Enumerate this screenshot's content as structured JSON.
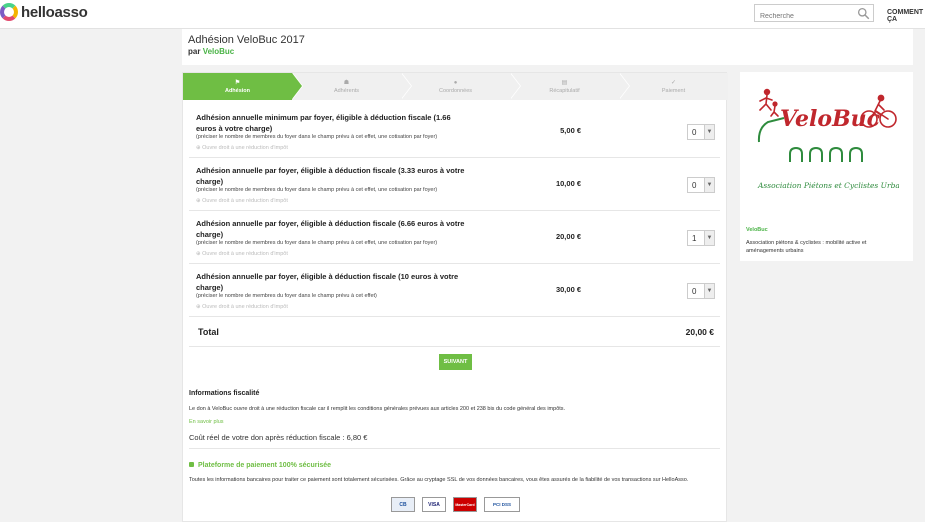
{
  "topbar": {
    "logo_text": "helloasso",
    "search_placeholder": "Recherche",
    "connect_label": "COMMENT ÇA"
  },
  "header": {
    "title": "Adhésion VeloBuc 2017",
    "by_prefix": "par",
    "organization": "VeloBuc"
  },
  "steps": [
    {
      "label": "Adhésion",
      "icon": "flag-icon",
      "glyph": "⚑",
      "active": true
    },
    {
      "label": "Adhérents",
      "icon": "users-icon",
      "glyph": "☗",
      "active": false
    },
    {
      "label": "Coordonnées",
      "icon": "user-icon",
      "glyph": "●",
      "active": false
    },
    {
      "label": "Récapitulatif",
      "icon": "list-icon",
      "glyph": "▤",
      "active": false
    },
    {
      "label": "Paiement",
      "icon": "check-icon",
      "glyph": "✓",
      "active": false
    }
  ],
  "rows": [
    {
      "title": "Adhésion annuelle minimum par foyer, éligible à déduction fiscale (1.66 euros à votre charge)",
      "note": "(préciser le nombre de membres du foyer dans le champ prévu à cet effet, une cotisation par foyer)",
      "tax": "⊕ Ouvre droit à une réduction d'impôt",
      "price": "5,00 €",
      "qty": "0"
    },
    {
      "title": "Adhésion annuelle par foyer, éligible à déduction fiscale (3.33 euros à votre charge)",
      "note": "(préciser le nombre de membres du foyer dans le champ prévu à cet effet, une cotisation par foyer)",
      "tax": "⊕ Ouvre droit à une réduction d'impôt",
      "price": "10,00 €",
      "qty": "0"
    },
    {
      "title": "Adhésion annuelle par foyer, éligible à déduction fiscale (6.66 euros à votre charge)",
      "note": "(préciser le nombre de membres du foyer dans le champ prévu à cet effet, une cotisation par foyer)",
      "tax": "⊕ Ouvre droit à une réduction d'impôt",
      "price": "20,00 €",
      "qty": "1"
    },
    {
      "title": "Adhésion annuelle par foyer, éligible à déduction fiscale (10 euros à votre charge)",
      "note": "(préciser le nombre de membres du foyer dans le champ prévu à cet effet)",
      "tax": "⊕ Ouvre droit à une réduction d'impôt",
      "price": "30,00 €",
      "qty": "0"
    }
  ],
  "total": {
    "label": "Total",
    "value": "20,00 €"
  },
  "next_label": "SUIVANT",
  "fiscal": {
    "title": "Informations fiscalité",
    "text": "Le don à VeloBuc ouvre droit à une réduction fiscale car il remplit les conditions générales prévues aux articles 200 et 238 bis du code général des impôts.",
    "more": "En savoir plus",
    "real_cost": "Coût réel de votre don après réduction fiscale : 6,80 €"
  },
  "secure": {
    "title": "Plateforme de paiement 100% sécurisée",
    "text": "Toutes les informations bancaires pour traiter ce paiement sont totalement sécurisées. Grâce au cryptage SSL de vos données bancaires, vous êtes assurés de la fiabilité de vos transactions sur HelloAsso."
  },
  "cards": [
    "CB",
    "VISA",
    "MasterCard",
    "PCI DSS"
  ],
  "sidebar": {
    "logo_text": "VeloBuc",
    "logo_subtitle": "Association Piétons et Cyclistes Urbains",
    "name": "VeloBuc",
    "description": "Association piétons & cyclistes : mobilité active et aménagements urbains"
  },
  "colors": {
    "accent": "#6fbe44",
    "brand_text": "#4ab346",
    "logo_red": "#c0272d",
    "logo_green": "#2e8b3d"
  }
}
